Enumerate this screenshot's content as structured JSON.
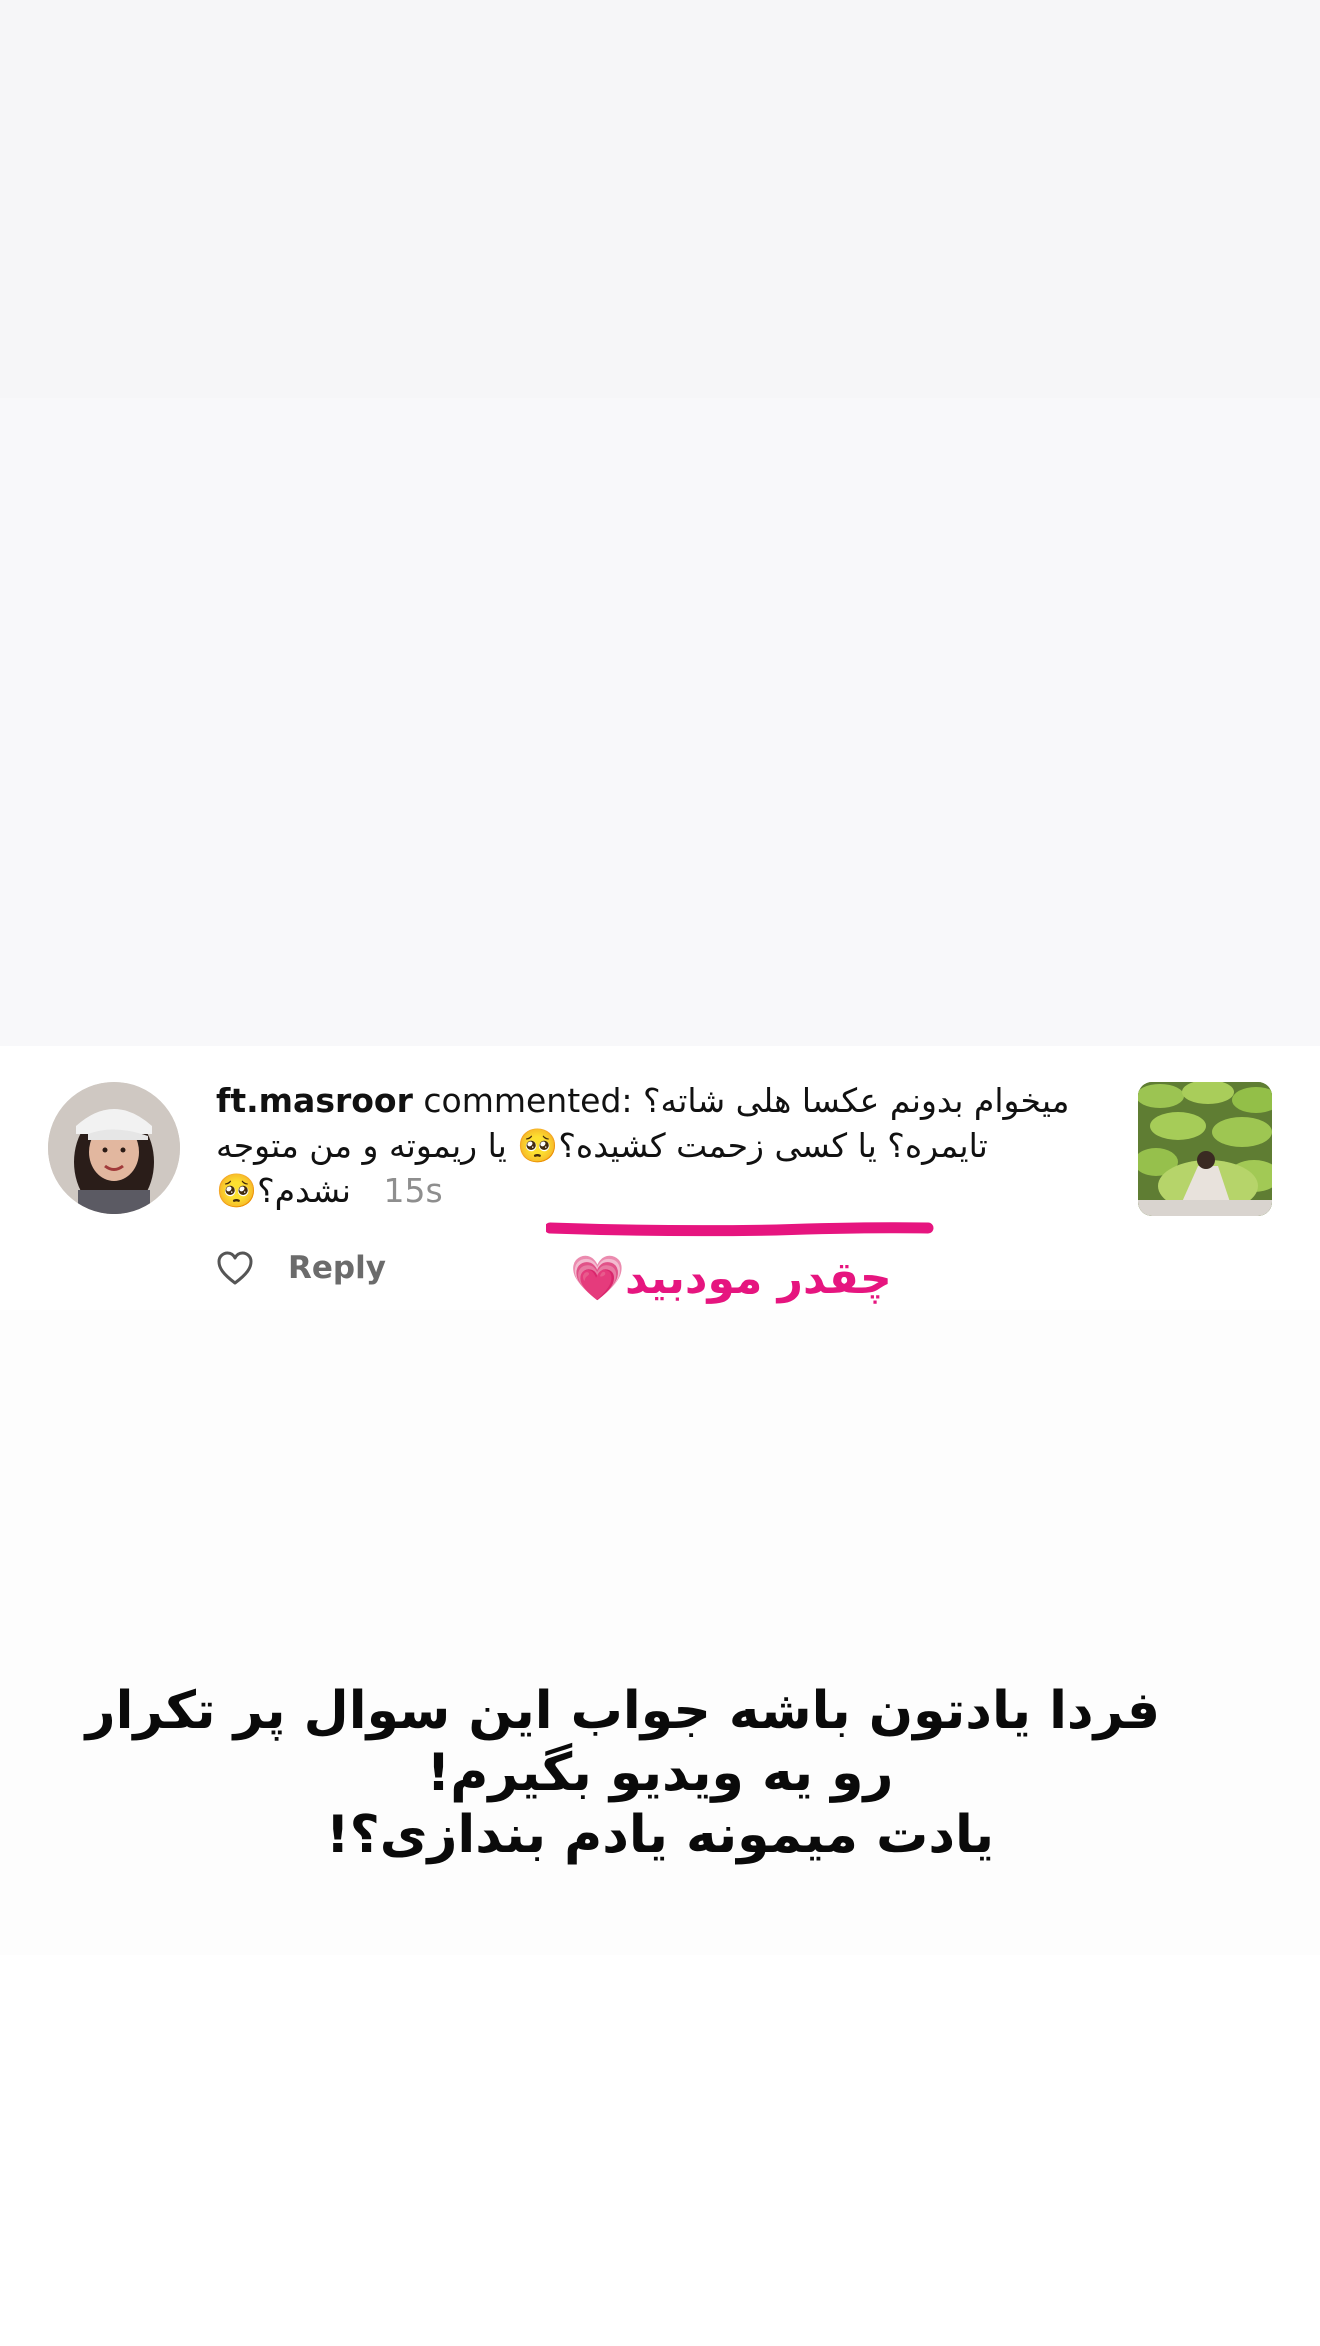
{
  "notification": {
    "username": "ft.masroor",
    "action": "commented:",
    "comment_line1": "میخوام بدونم عکسا هلی شاته؟",
    "comment_line2": "تایمره؟ یا کسی زحمت کشیده؟🥺 یا ریموته و من متوجه",
    "comment_line3": "نشدم؟🥺",
    "time": "15s",
    "reply_label": "Reply",
    "icons": {
      "like": "heart-outline-icon"
    }
  },
  "annotation": {
    "text": "چقدر مودبید",
    "emoji": "💗",
    "color": "#e6157f"
  },
  "caption": {
    "line1": "فردا یادتون باشه جواب این سوال پر تکرار",
    "line2": "رو یه ویدیو بگیرم!",
    "line3": "یادت میمونه یادم بندازی؟!"
  }
}
